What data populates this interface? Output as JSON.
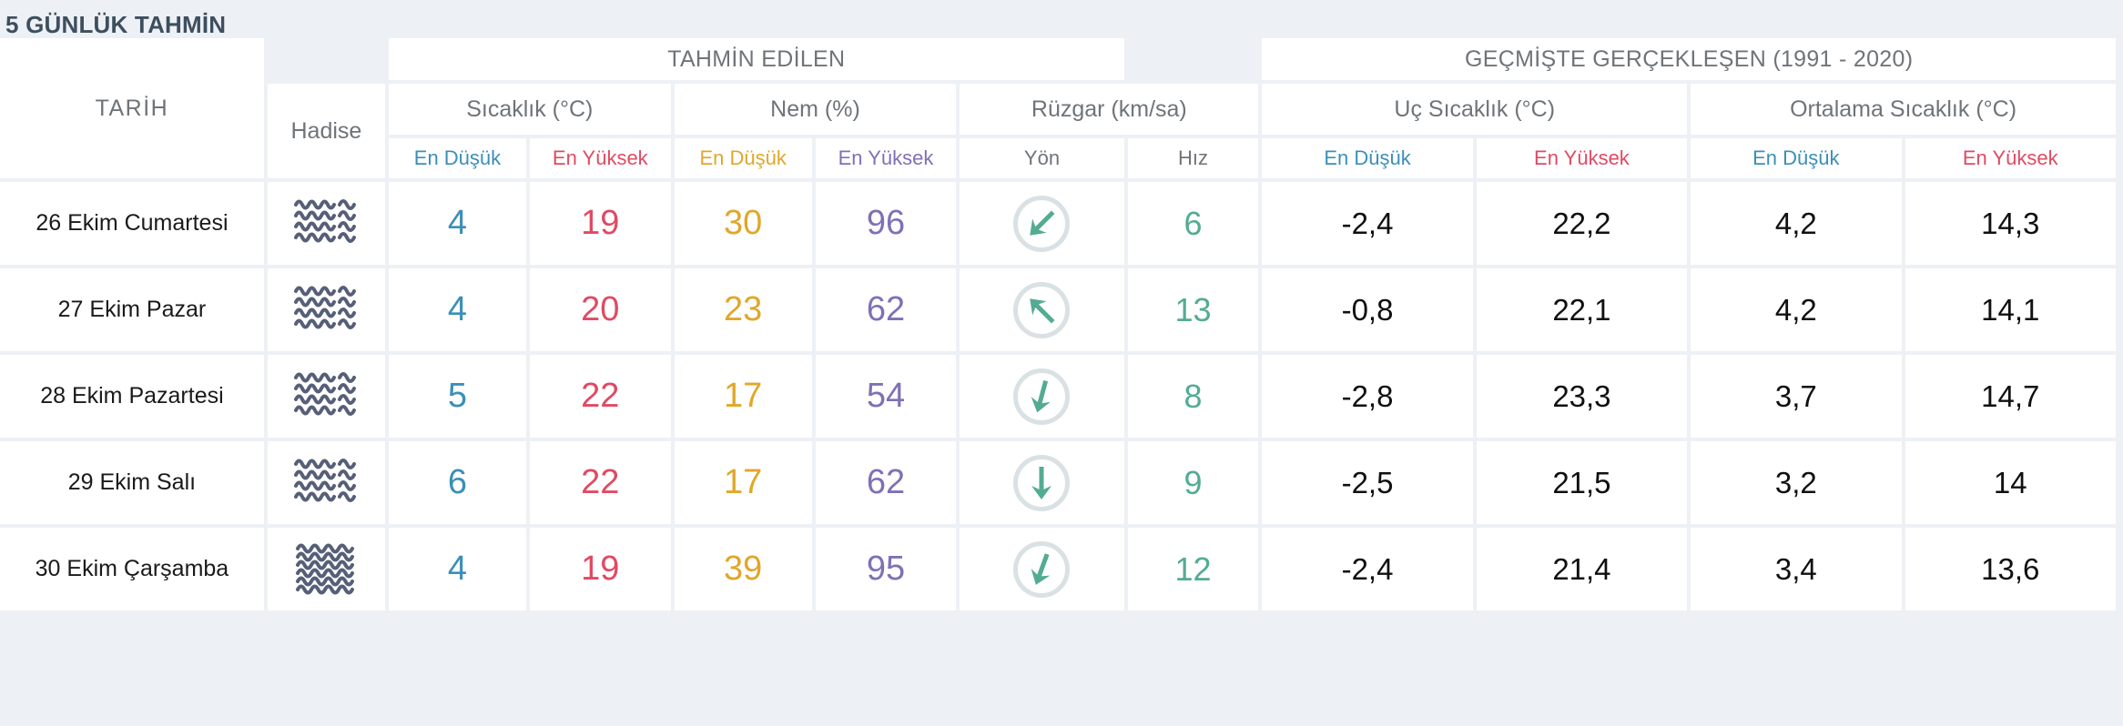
{
  "panel": {
    "title": "5 GÜNLÜK TAHMİN"
  },
  "colors": {
    "background": "#edf1f5",
    "cell": "#ffffff",
    "title": "#3d4f5e",
    "header_text": "#6f7479",
    "low_temp": "#3b8fb8",
    "high_temp": "#e04a63",
    "low_humidity": "#e0a72a",
    "high_humidity": "#8070b5",
    "wind": "#54ab93",
    "wind_dial_ring": "#d9e1e4",
    "weather_icon": "#575f78",
    "historical_text": "#101010"
  },
  "header": {
    "date_column": "TARİH",
    "event_column": "Hadise",
    "groups": [
      {
        "label": "TAHMİN EDİLEN",
        "span": 5
      },
      {
        "label": "GEÇMİŞTE GERÇEKLEŞEN (1991 - 2020)",
        "span": 4
      }
    ],
    "subgroups": [
      {
        "label": "Sıcaklık (°C)",
        "span": 2
      },
      {
        "label": "Nem (%)",
        "span": 2
      },
      {
        "label": "Rüzgar (km/sa)",
        "span": 2
      },
      {
        "label": "Uç Sıcaklık (°C)",
        "span": 2
      },
      {
        "label": "Ortalama Sıcaklık (°C)",
        "span": 2
      }
    ],
    "columns": [
      {
        "label": "En Düşük",
        "color_key": "low_temp"
      },
      {
        "label": "En Yüksek",
        "color_key": "high_temp"
      },
      {
        "label": "En Düşük",
        "color_key": "low_humidity"
      },
      {
        "label": "En Yüksek",
        "color_key": "high_humidity"
      },
      {
        "label": "Yön",
        "color_key": "header_text"
      },
      {
        "label": "Hız",
        "color_key": "header_text"
      },
      {
        "label": "En Düşük",
        "color_key": "low_temp"
      },
      {
        "label": "En Yüksek",
        "color_key": "high_temp"
      },
      {
        "label": "En Düşük",
        "color_key": "low_temp"
      },
      {
        "label": "En Yüksek",
        "color_key": "high_temp"
      }
    ]
  },
  "rows": [
    {
      "date": "26 Ekim Cumartesi",
      "weather_icon": "fog-icon",
      "temp_min": "4",
      "temp_max": "19",
      "humidity_min": "30",
      "humidity_max": "96",
      "wind_direction_icon": "arrow-southwest-icon",
      "wind_direction_deg": 225,
      "wind_speed": "6",
      "hist_extreme_min": "-2,4",
      "hist_extreme_max": "22,2",
      "hist_avg_min": "4,2",
      "hist_avg_max": "14,3"
    },
    {
      "date": "27 Ekim Pazar",
      "weather_icon": "fog-icon",
      "temp_min": "4",
      "temp_max": "20",
      "humidity_min": "23",
      "humidity_max": "62",
      "wind_direction_icon": "arrow-northwest-icon",
      "wind_direction_deg": 315,
      "wind_speed": "13",
      "hist_extreme_min": "-0,8",
      "hist_extreme_max": "22,1",
      "hist_avg_min": "4,2",
      "hist_avg_max": "14,1"
    },
    {
      "date": "28 Ekim Pazartesi",
      "weather_icon": "fog-icon",
      "temp_min": "5",
      "temp_max": "22",
      "humidity_min": "17",
      "humidity_max": "54",
      "wind_direction_icon": "arrow-south-southeast-icon",
      "wind_direction_deg": 195,
      "wind_speed": "8",
      "hist_extreme_min": "-2,8",
      "hist_extreme_max": "23,3",
      "hist_avg_min": "3,7",
      "hist_avg_max": "14,7"
    },
    {
      "date": "29 Ekim Salı",
      "weather_icon": "fog-icon",
      "temp_min": "6",
      "temp_max": "22",
      "humidity_min": "17",
      "humidity_max": "62",
      "wind_direction_icon": "arrow-south-icon",
      "wind_direction_deg": 180,
      "wind_speed": "9",
      "hist_extreme_min": "-2,5",
      "hist_extreme_max": "21,5",
      "hist_avg_min": "3,2",
      "hist_avg_max": "14"
    },
    {
      "date": "30 Ekim Çarşamba",
      "weather_icon": "dense-fog-icon",
      "temp_min": "4",
      "temp_max": "19",
      "humidity_min": "39",
      "humidity_max": "95",
      "wind_direction_icon": "arrow-south-southwest-icon",
      "wind_direction_deg": 200,
      "wind_speed": "12",
      "hist_extreme_min": "-2,4",
      "hist_extreme_max": "21,4",
      "hist_avg_min": "3,4",
      "hist_avg_max": "13,6"
    }
  ]
}
